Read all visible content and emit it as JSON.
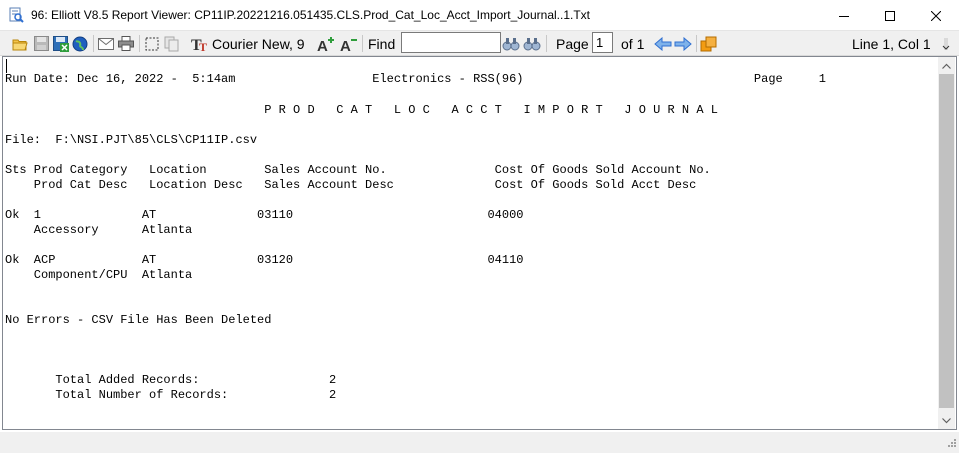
{
  "window": {
    "title": "96: Elliott V8.5 Report Viewer: CP11IP.20221216.051435.CLS.Prod_Cat_Loc_Acct_Import_Journal..1.Txt"
  },
  "toolbar": {
    "font_label": "Courier New, 9",
    "find_label": "Find",
    "find_value": "",
    "page_label": "Page",
    "page_value": "1",
    "page_of": "of 1",
    "position": "Line 1, Col 1"
  },
  "report": {
    "lines": [
      "Run Date: Dec 16, 2022 -  5:14am                   Electronics - RSS(96)                                Page     1",
      "                                    P R O D   C A T   L O C   A C C T   I M P O R T   J O U R N A L",
      "",
      "File:  F:\\NSI.PJT\\85\\CLS\\CP11IP.csv",
      "",
      "Sts Prod Category   Location        Sales Account No.               Cost Of Goods Sold Account No.",
      "    Prod Cat Desc   Location Desc   Sales Account Desc              Cost Of Goods Sold Acct Desc",
      "",
      "Ok  1              AT              03110                           04000",
      "    Accessory      Atlanta",
      "",
      "Ok  ACP            AT              03120                           04110",
      "    Component/CPU  Atlanta",
      "",
      "",
      "No Errors - CSV File Has Been Deleted",
      "",
      "",
      "",
      "       Total Added Records:                  2",
      "       Total Number of Records:              2"
    ]
  },
  "icons": {
    "app": "report-viewer-icon",
    "accent_blue": "#2f6fd1",
    "accent_orange": "#f39c12",
    "accent_green": "#3a9a3a"
  }
}
